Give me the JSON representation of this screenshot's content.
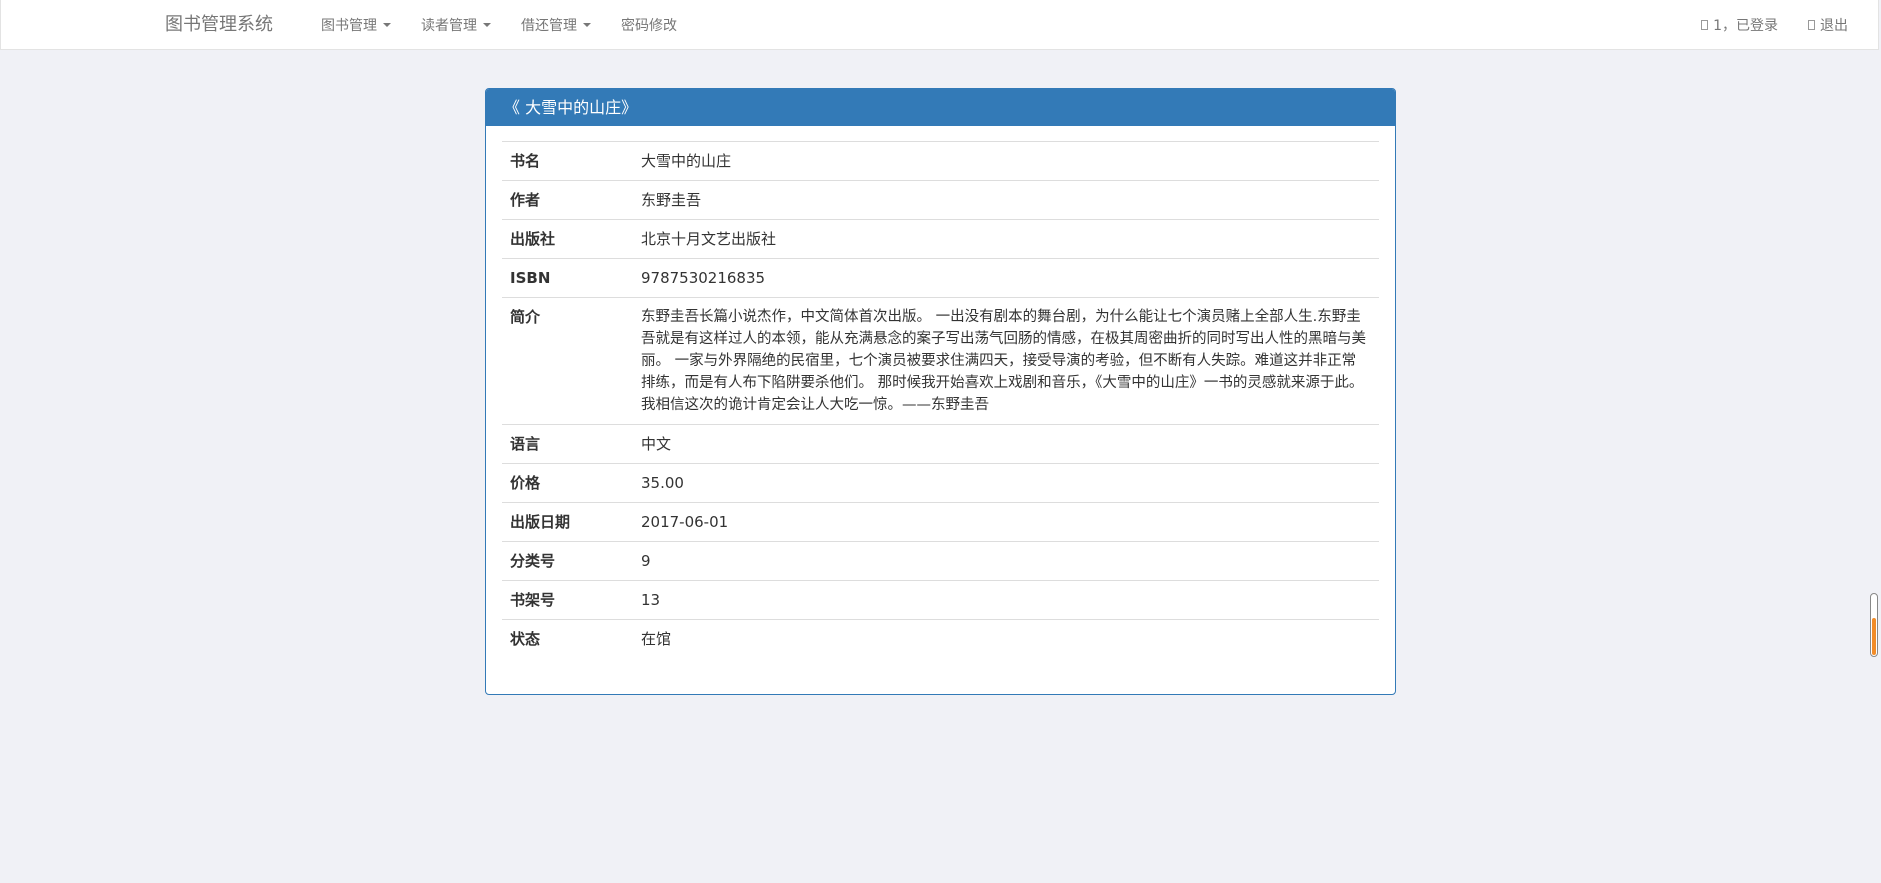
{
  "navbar": {
    "brand": "图书管理系统",
    "menu": [
      {
        "label": "图书管理",
        "dropdown": true
      },
      {
        "label": "读者管理",
        "dropdown": true
      },
      {
        "label": "借还管理",
        "dropdown": true
      },
      {
        "label": "密码修改",
        "dropdown": false
      }
    ],
    "user_status": "1，已登录",
    "logout": "退出",
    "icons": [
      "user-icon",
      "logout-icon"
    ]
  },
  "panel": {
    "title": "《 大雪中的山庄》",
    "rows": [
      {
        "label": "书名",
        "value": "大雪中的山庄"
      },
      {
        "label": "作者",
        "value": "东野圭吾"
      },
      {
        "label": "出版社",
        "value": "北京十月文艺出版社"
      },
      {
        "label": "ISBN",
        "value": "9787530216835"
      },
      {
        "label": "简介",
        "value": "东野圭吾长篇小说杰作，中文简体首次出版。 一出没有剧本的舞台剧，为什么能让七个演员赌上全部人生.东野圭吾就是有这样过人的本领，能从充满悬念的案子写出荡气回肠的情感，在极其周密曲折的同时写出人性的黑暗与美丽。 一家与外界隔绝的民宿里，七个演员被要求住满四天，接受导演的考验，但不断有人失踪。难道这并非正常排练，而是有人布下陷阱要杀他们。 那时候我开始喜欢上戏剧和音乐，《大雪中的山庄》一书的灵感就来源于此。我相信这次的诡计肯定会让人大吃一惊。——东野圭吾"
      },
      {
        "label": "语言",
        "value": "中文"
      },
      {
        "label": "价格",
        "value": "35.00"
      },
      {
        "label": "出版日期",
        "value": "2017-06-01"
      },
      {
        "label": "分类号",
        "value": "9"
      },
      {
        "label": "书架号",
        "value": "13"
      },
      {
        "label": "状态",
        "value": "在馆"
      }
    ]
  },
  "scroll_indicator": {
    "level": 0.6,
    "accent": "#f28c28"
  },
  "colors": {
    "primary": "#337ab7",
    "background": "#f0f1f6"
  }
}
